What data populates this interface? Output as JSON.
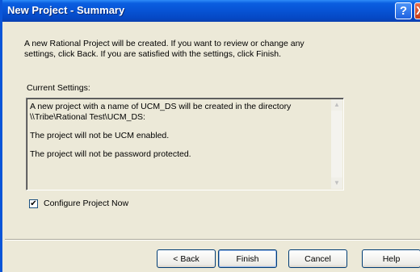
{
  "window": {
    "title": "New Project - Summary",
    "help_glyph": "?",
    "close_glyph": "X"
  },
  "intro": {
    "line1": "A new Rational Project will be created.  If you want to review or change any",
    "line2": "settings, click Back.  If you are satisfied with the settings, click Finish."
  },
  "settings": {
    "label": "Current Settings:",
    "lines": [
      "A new project with a name of UCM_DS will be created in the directory",
      "\\\\Tribe\\Rational Test\\UCM_DS:",
      "The project will not be UCM enabled.",
      "The project will not be password protected."
    ]
  },
  "configure": {
    "label": "Configure Project Now",
    "checked": true,
    "check_glyph": "✔"
  },
  "buttons": {
    "back": "< Back",
    "finish": "Finish",
    "cancel": "Cancel",
    "help": "Help"
  },
  "icons": {
    "help": "help-icon",
    "close": "close-icon",
    "scroll_up": "scroll-up-arrow-icon",
    "scroll_down": "scroll-down-arrow-icon"
  }
}
